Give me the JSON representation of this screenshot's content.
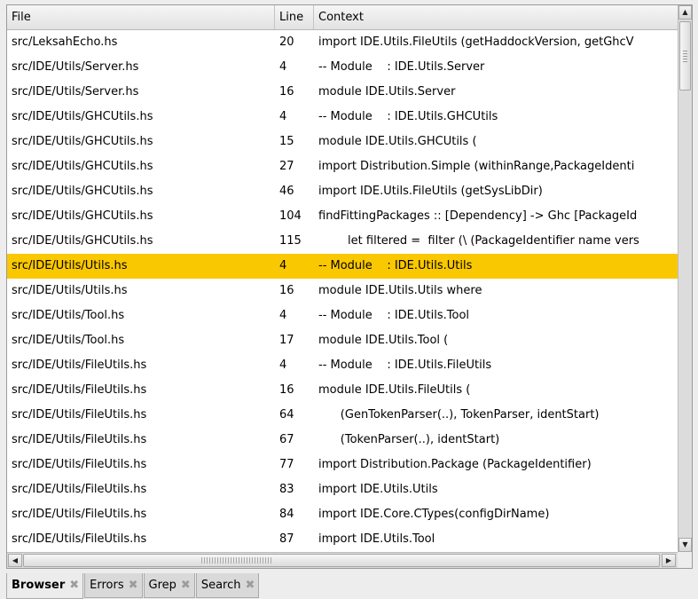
{
  "columns": {
    "file": "File",
    "line": "Line",
    "context": "Context"
  },
  "rows": [
    {
      "file": "src/LeksahEcho.hs",
      "line": "20",
      "context": "import IDE.Utils.FileUtils (getHaddockVersion, getGhcV"
    },
    {
      "file": "src/IDE/Utils/Server.hs",
      "line": "4",
      "context": "-- Module    : IDE.Utils.Server"
    },
    {
      "file": "src/IDE/Utils/Server.hs",
      "line": "16",
      "context": "module IDE.Utils.Server"
    },
    {
      "file": "src/IDE/Utils/GHCUtils.hs",
      "line": "4",
      "context": "-- Module    : IDE.Utils.GHCUtils"
    },
    {
      "file": "src/IDE/Utils/GHCUtils.hs",
      "line": "15",
      "context": "module IDE.Utils.GHCUtils ("
    },
    {
      "file": "src/IDE/Utils/GHCUtils.hs",
      "line": "27",
      "context": "import Distribution.Simple (withinRange,PackageIdenti"
    },
    {
      "file": "src/IDE/Utils/GHCUtils.hs",
      "line": "46",
      "context": "import IDE.Utils.FileUtils (getSysLibDir)"
    },
    {
      "file": "src/IDE/Utils/GHCUtils.hs",
      "line": "104",
      "context": "findFittingPackages :: [Dependency] -> Ghc [PackageId"
    },
    {
      "file": "src/IDE/Utils/GHCUtils.hs",
      "line": "115",
      "context": "        let filtered =  filter (\\ (PackageIdentifier name vers"
    },
    {
      "file": "src/IDE/Utils/Utils.hs",
      "line": "4",
      "context": "-- Module    : IDE.Utils.Utils",
      "selected": true
    },
    {
      "file": "src/IDE/Utils/Utils.hs",
      "line": "16",
      "context": "module IDE.Utils.Utils where"
    },
    {
      "file": "src/IDE/Utils/Tool.hs",
      "line": "4",
      "context": "-- Module    : IDE.Utils.Tool"
    },
    {
      "file": "src/IDE/Utils/Tool.hs",
      "line": "17",
      "context": "module IDE.Utils.Tool ("
    },
    {
      "file": "src/IDE/Utils/FileUtils.hs",
      "line": "4",
      "context": "-- Module    : IDE.Utils.FileUtils"
    },
    {
      "file": "src/IDE/Utils/FileUtils.hs",
      "line": "16",
      "context": "module IDE.Utils.FileUtils ("
    },
    {
      "file": "src/IDE/Utils/FileUtils.hs",
      "line": "64",
      "context": "      (GenTokenParser(..), TokenParser, identStart)"
    },
    {
      "file": "src/IDE/Utils/FileUtils.hs",
      "line": "67",
      "context": "      (TokenParser(..), identStart)"
    },
    {
      "file": "src/IDE/Utils/FileUtils.hs",
      "line": "77",
      "context": "import Distribution.Package (PackageIdentifier)"
    },
    {
      "file": "src/IDE/Utils/FileUtils.hs",
      "line": "83",
      "context": "import IDE.Utils.Utils"
    },
    {
      "file": "src/IDE/Utils/FileUtils.hs",
      "line": "84",
      "context": "import IDE.Core.CTypes(configDirName)"
    },
    {
      "file": "src/IDE/Utils/FileUtils.hs",
      "line": "87",
      "context": "import IDE.Utils.Tool"
    }
  ],
  "tabs": [
    {
      "label": "Browser",
      "active": true,
      "icon": "close-icon"
    },
    {
      "label": "Errors",
      "active": false,
      "icon": "close-icon"
    },
    {
      "label": "Grep",
      "active": false,
      "icon": "close-icon"
    },
    {
      "label": "Search",
      "active": false,
      "icon": "close-icon"
    }
  ],
  "colors": {
    "selection": "#fac800",
    "background": "#ffffff",
    "chrome": "#ededed"
  }
}
